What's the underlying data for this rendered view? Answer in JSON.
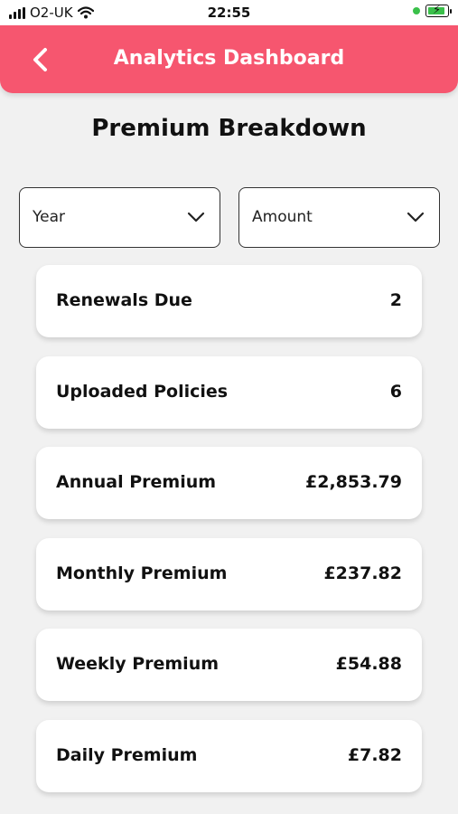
{
  "status_bar": {
    "carrier": "O2-UK",
    "time": "22:55",
    "battery_state": "charging"
  },
  "header": {
    "title": "Analytics Dashboard",
    "back_icon": "chevron-left-icon",
    "background_color": "#f6566f"
  },
  "page": {
    "title": "Premium Breakdown"
  },
  "filters": {
    "year": {
      "value": "Year",
      "icon": "chevron-down-icon"
    },
    "amount": {
      "value": "Amount",
      "icon": "chevron-down-icon"
    }
  },
  "stats": [
    {
      "label": "Renewals Due",
      "value": "2"
    },
    {
      "label": "Uploaded Policies",
      "value": "6"
    },
    {
      "label": "Annual Premium",
      "value": "£2,853.79"
    },
    {
      "label": "Monthly Premium",
      "value": "£237.82"
    },
    {
      "label": "Weekly Premium",
      "value": "£54.88"
    },
    {
      "label": "Daily Premium",
      "value": "£7.82"
    }
  ]
}
